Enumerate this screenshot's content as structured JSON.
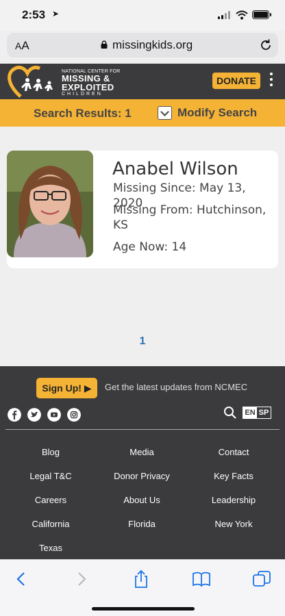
{
  "status_bar": {
    "time": "2:53",
    "location_icon": "location-arrow-icon"
  },
  "browser": {
    "text_size_label": "AA",
    "url": "missingkids.org"
  },
  "site_header": {
    "logo_line1": "NATIONAL CENTER FOR",
    "logo_line2": "MISSING &",
    "logo_line3": "EXPLOITED",
    "logo_line4": "CHILDREN",
    "donate_label": "DONATE",
    "colors": {
      "brand_dark": "#3b3b3d",
      "brand_gold": "#f5b335"
    }
  },
  "results_bar": {
    "count_text": "Search Results: 1",
    "modify_label": "Modify Search"
  },
  "result": {
    "name": "Anabel Wilson",
    "missing_since": "Missing Since: May 13, 2020",
    "missing_from_line1": "Missing From: Hutchinson,",
    "missing_from_line2": "KS",
    "age_now": "Age Now: 14"
  },
  "pagination": {
    "current_page": "1"
  },
  "footer": {
    "signup_label": "Sign Up! ▶",
    "signup_text": "Get the latest updates from NCMEC",
    "social_icons": [
      "facebook-icon",
      "twitter-icon",
      "youtube-icon",
      "instagram-icon"
    ],
    "lang_en": "EN",
    "lang_sp": "SP",
    "links": [
      "Blog",
      "Media",
      "Contact",
      "Legal T&C",
      "Donor Privacy",
      "Key Facts",
      "Careers",
      "About Us",
      "Leadership",
      "California",
      "Florida",
      "New York",
      "Texas"
    ]
  }
}
